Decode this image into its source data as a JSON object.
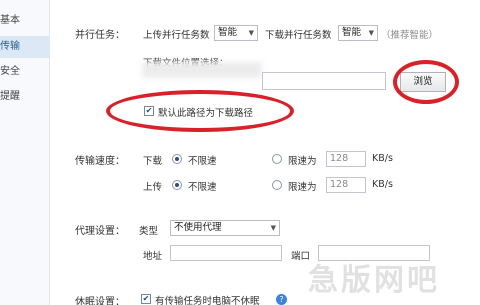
{
  "sidebar": {
    "items": [
      {
        "label": "基本"
      },
      {
        "label": "传输"
      },
      {
        "label": "安全"
      },
      {
        "label": "提醒"
      }
    ]
  },
  "parallel": {
    "section_label": "并行任务：",
    "upload_label": "上传并行任务数",
    "upload_value": "智能",
    "download_label": "下载并行任务数",
    "download_value": "智能",
    "hint": "（推荐智能）"
  },
  "download_location": {
    "label": "下载文件位置选择：",
    "path_value": "",
    "browse_label": "浏览",
    "default_checkbox_label": "默认此路径为下载路径",
    "default_checked": true
  },
  "speed": {
    "section_label": "传输速度：",
    "download_label": "下载",
    "upload_label": "上传",
    "unlimited_label": "不限速",
    "limit_label": "限速为",
    "download_limit_value": "128",
    "upload_limit_value": "128",
    "unit": "KB/s",
    "download_unlimited": true,
    "upload_unlimited": true
  },
  "proxy": {
    "section_label": "代理设置：",
    "type_label": "类型",
    "type_value": "不使用代理",
    "address_label": "地址",
    "port_label": "端口"
  },
  "sleep": {
    "section_label": "休眠设置：",
    "checkbox_label": "有传输任务时电脑不休眠",
    "checked": true
  },
  "watermark": {
    "text": "急版网吧"
  },
  "colors": {
    "annotation_red": "#d8222a",
    "active_sidebar": "#dde8f6"
  }
}
